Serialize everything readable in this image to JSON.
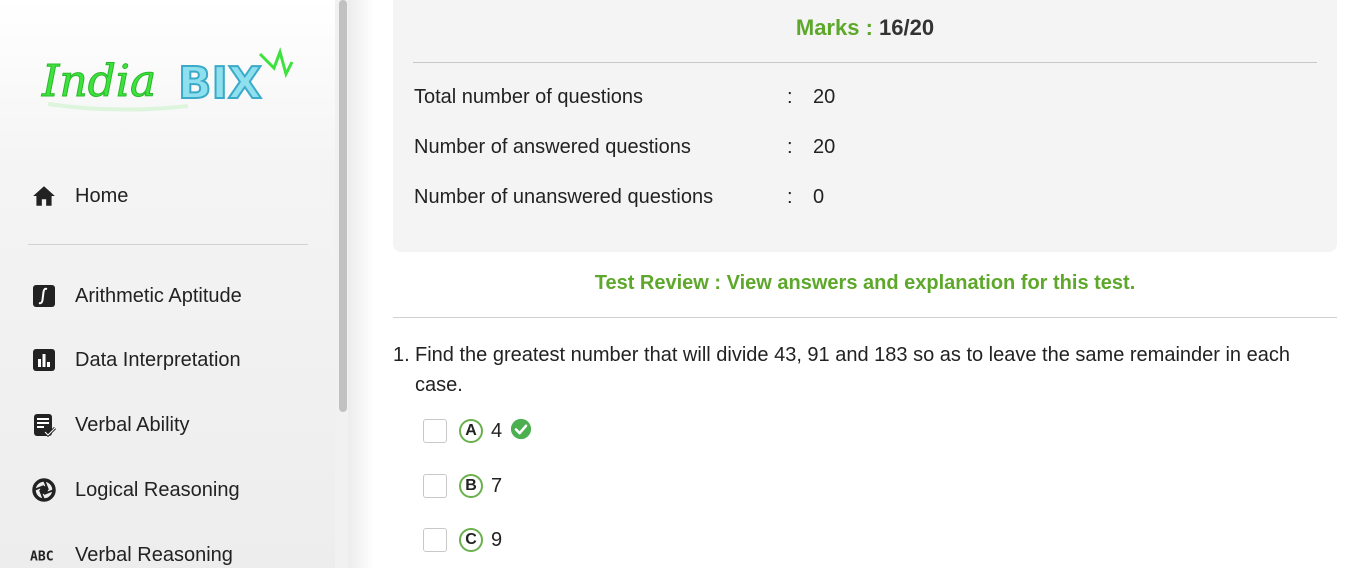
{
  "logo": {
    "text_part1": "India",
    "text_part2": "BIX"
  },
  "sidebar": {
    "items": [
      {
        "label": "Home",
        "icon": "home-icon"
      },
      {
        "label": "Arithmetic Aptitude",
        "icon": "integral-icon"
      },
      {
        "label": "Data Interpretation",
        "icon": "bar-chart-icon"
      },
      {
        "label": "Verbal Ability",
        "icon": "document-check-icon"
      },
      {
        "label": "Logical Reasoning",
        "icon": "aperture-icon"
      },
      {
        "label": "Verbal Reasoning",
        "icon": "abc-icon"
      }
    ]
  },
  "summary": {
    "marks_label": "Marks :",
    "marks_value": "16/20",
    "rows": [
      {
        "label": "Total number of questions",
        "sep": ":",
        "value": "20"
      },
      {
        "label": "Number of answered questions",
        "sep": ":",
        "value": "20"
      },
      {
        "label": "Number of unanswered questions",
        "sep": ":",
        "value": "0"
      }
    ]
  },
  "review_link": "Test Review : View answers and explanation for this test.",
  "question": {
    "number": "1.",
    "text": "Find the greatest number that will divide 43, 91 and 183 so as to leave the same remainder in each case.",
    "options": [
      {
        "letter": "A",
        "text": "4",
        "correct": true
      },
      {
        "letter": "B",
        "text": "7",
        "correct": false
      },
      {
        "letter": "C",
        "text": "9",
        "correct": false
      }
    ]
  },
  "colors": {
    "accent_green": "#5da82b",
    "check_green": "#4caf50"
  }
}
